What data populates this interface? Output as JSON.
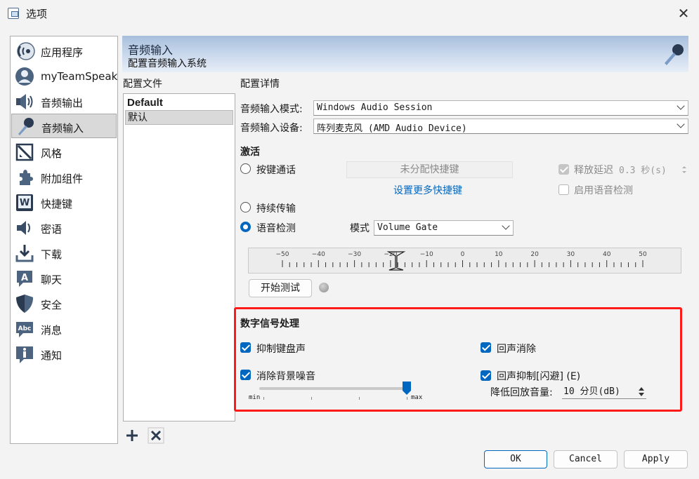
{
  "window": {
    "title": "选项"
  },
  "nav": {
    "items": [
      {
        "label": "应用程序",
        "icon": "application-icon"
      },
      {
        "label": "myTeamSpeak",
        "icon": "myteamspeak-icon"
      },
      {
        "label": "音频输出",
        "icon": "speaker-icon"
      },
      {
        "label": "音频输入",
        "icon": "microphone-icon",
        "selected": true
      },
      {
        "label": "风格",
        "icon": "style-icon"
      },
      {
        "label": "附加组件",
        "icon": "addon-puzzle-icon"
      },
      {
        "label": "快捷键",
        "icon": "hotkey-icon"
      },
      {
        "label": "密语",
        "icon": "whisper-icon"
      },
      {
        "label": "下载",
        "icon": "download-icon"
      },
      {
        "label": "聊天",
        "icon": "chat-icon"
      },
      {
        "label": "安全",
        "icon": "security-shield-icon"
      },
      {
        "label": "消息",
        "icon": "messages-icon"
      },
      {
        "label": "通知",
        "icon": "notification-info-icon"
      }
    ]
  },
  "header": {
    "title": "音频输入",
    "subtitle": "配置音频输入系统"
  },
  "profiles": {
    "label": "配置文件",
    "items": [
      "Default",
      "默认"
    ],
    "selected_index": 1
  },
  "details": {
    "label": "配置详情",
    "mode_label": "音频输入模式:",
    "mode_value": "Windows Audio Session",
    "device_label": "音频输入设备:",
    "device_value": "阵列麦克风 (AMD Audio Device)"
  },
  "activation": {
    "title": "激活",
    "ptt_label": "按键通话",
    "shortcut_placeholder": "未分配快捷键",
    "more_shortcuts_link": "设置更多快捷键",
    "release_delay_label": "释放延迟",
    "release_delay_value": "0.3 秒(s)",
    "enable_vad_label": "启用语音检测",
    "continuous_label": "持续传输",
    "vad_label": "语音检测",
    "vad_selected": true,
    "mode_label": "模式",
    "mode_value": "Volume Gate"
  },
  "meter": {
    "scale_labels": [
      "−50",
      "−40",
      "−30",
      "−20",
      "−10",
      "0",
      "10",
      "20",
      "30",
      "40",
      "50"
    ],
    "threshold_db": -20
  },
  "test": {
    "start_label": "开始测试"
  },
  "dsp": {
    "title": "数字信号处理",
    "suppress_keyboard_label": "抑制键盘声",
    "suppress_keyboard": true,
    "echo_cancel_label": "回声消除",
    "echo_cancel": true,
    "noise_removal_label": "消除背景噪音",
    "noise_removal": true,
    "noise_slider_min": "min",
    "noise_slider_max": "max",
    "noise_slider_level": 0.95,
    "ducking_label": "回声抑制[闪避] (E)",
    "ducking": true,
    "lower_volume_label": "降低回放音量:",
    "lower_volume_value": "10 分贝(dB)"
  },
  "footer": {
    "ok": "OK",
    "cancel": "Cancel",
    "apply": "Apply"
  },
  "colors": {
    "accent": "#0067c0",
    "highlight_box": "#ff1a1a"
  }
}
